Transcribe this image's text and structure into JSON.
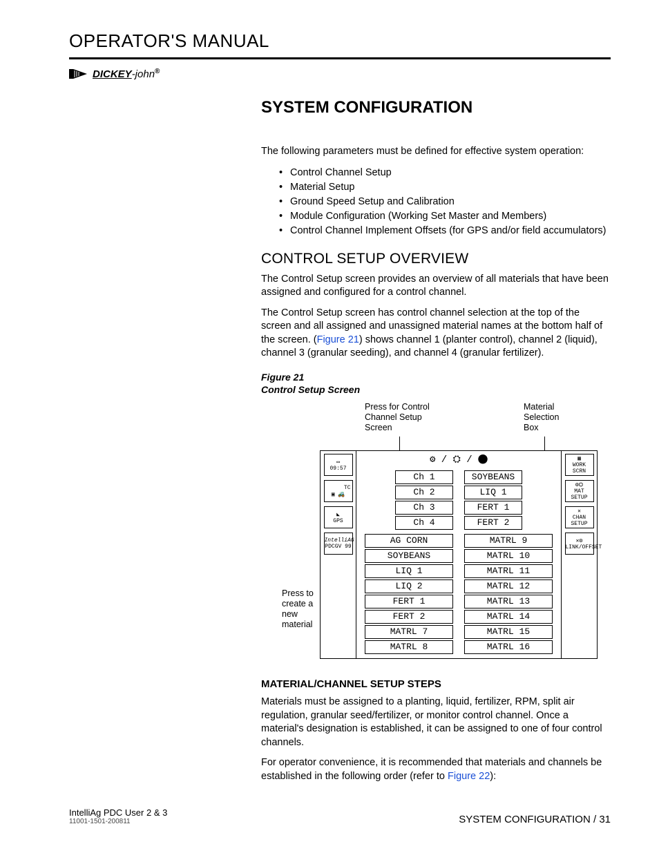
{
  "header": {
    "page_title": "OPERATOR'S MANUAL",
    "brand": "DICKEY-john"
  },
  "section": {
    "title": "SYSTEM CONFIGURATION",
    "intro": "The following parameters must be defined for effective system operation:",
    "bullets": [
      "Control Channel Setup",
      "Material Setup",
      "Ground Speed Setup and Calibration",
      "Module Configuration (Working Set Master and Members)",
      "Control Channel Implement Offsets (for GPS and/or field accumulators)"
    ]
  },
  "overview": {
    "heading": "CONTROL SETUP OVERVIEW",
    "p1": "The Control Setup screen provides an overview of all materials that have been assigned and configured for a control channel.",
    "p2a": "The Control Setup screen has control channel selection at the top of the screen and all assigned and unassigned material names at the bottom half of the screen. (",
    "fig_link": "Figure 21",
    "p2b": ") shows channel 1 (planter control), channel 2 (liquid), channel 3 (granular seeding), and channel 4 (granular fertilizer)."
  },
  "figure": {
    "label": "Figure 21",
    "caption": "Control Setup Screen",
    "callout_top_left": "Press for Control Channel Setup Screen",
    "callout_top_right": "Material Selection Box",
    "callout_left": "Press to create a new material",
    "left_icons": {
      "time": "09:57",
      "tc": "TC",
      "gps": "GPS",
      "brand": "IntelliAG",
      "sub": "PDCGV 99"
    },
    "right_icons": [
      "WORK SCRN",
      "MAT SETUP",
      "CHAN SETUP",
      "LINK/OFFSET"
    ],
    "channels": [
      {
        "ch": "Ch 1",
        "mat": "SOYBEANS"
      },
      {
        "ch": "Ch 2",
        "mat": "LIQ 1"
      },
      {
        "ch": "Ch 3",
        "mat": "FERT 1"
      },
      {
        "ch": "Ch 4",
        "mat": "FERT 2"
      }
    ],
    "materials_left": [
      "AG CORN",
      "SOYBEANS",
      "LIQ 1",
      "LIQ 2",
      "FERT 1",
      "FERT 2",
      "MATRL 7",
      "MATRL 8"
    ],
    "materials_right": [
      "MATRL 9",
      "MATRL 10",
      "MATRL 11",
      "MATRL 12",
      "MATRL 13",
      "MATRL 14",
      "MATRL 15",
      "MATRL 16"
    ]
  },
  "steps": {
    "heading": "MATERIAL/CHANNEL SETUP STEPS",
    "p1": "Materials must be assigned to a planting, liquid, fertilizer, RPM, split air regulation, granular seed/fertilizer, or monitor control channel.  Once a material's designation is established, it can be assigned to one of four control channels.",
    "p2a": "For operator convenience, it is recommended that materials and channels be established in the following order (refer to ",
    "fig_link": "Figure 22",
    "p2b": "):"
  },
  "footer": {
    "left_line1": "IntelliAg PDC User 2 & 3",
    "left_line2": "11001-1501-200811",
    "right": "SYSTEM CONFIGURATION / 31"
  }
}
